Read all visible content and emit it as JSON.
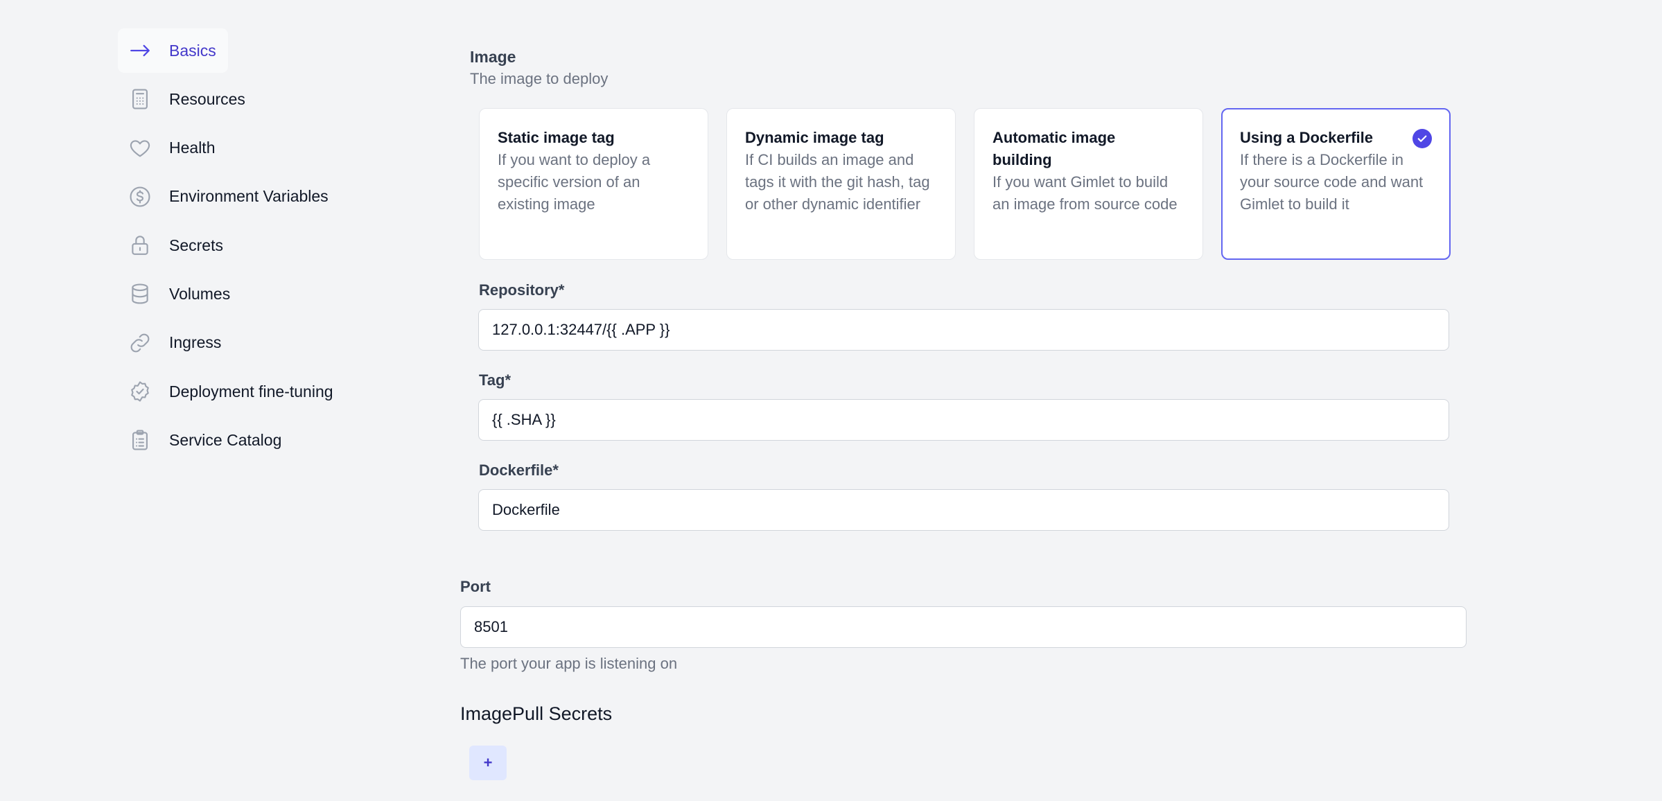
{
  "sidebar": {
    "items": [
      {
        "label": "Basics",
        "icon": "arrow-right-icon",
        "active": true
      },
      {
        "label": "Resources",
        "icon": "calculator-icon"
      },
      {
        "label": "Health",
        "icon": "heart-icon"
      },
      {
        "label": "Environment Variables",
        "icon": "currency-dollar-icon"
      },
      {
        "label": "Secrets",
        "icon": "lock-icon"
      },
      {
        "label": "Volumes",
        "icon": "database-icon"
      },
      {
        "label": "Ingress",
        "icon": "link-icon"
      },
      {
        "label": "Deployment fine-tuning",
        "icon": "badge-check-icon"
      },
      {
        "label": "Service Catalog",
        "icon": "clipboard-list-icon"
      }
    ]
  },
  "image": {
    "title": "Image",
    "description": "The image to deploy",
    "options": [
      {
        "title": "Static image tag",
        "description": "If you want to deploy a specific version of an existing image"
      },
      {
        "title": "Dynamic image tag",
        "description": "If CI builds an image and tags it with the git hash, tag or other dynamic identifier"
      },
      {
        "title": "Automatic image building",
        "description": "If you want Gimlet to build an image from source code"
      },
      {
        "title": "Using a Dockerfile",
        "description": "If there is a Dockerfile in your source code and want Gimlet to build it",
        "selected": true
      }
    ]
  },
  "repository": {
    "label": "Repository*",
    "value": "127.0.0.1:32447/{{ .APP }}"
  },
  "tag": {
    "label": "Tag*",
    "value": "{{ .SHA }}"
  },
  "dockerfile": {
    "label": "Dockerfile*",
    "value": "Dockerfile"
  },
  "port": {
    "label": "Port",
    "value": "8501",
    "help": "The port your app is listening on"
  },
  "imagepull": {
    "title": "ImagePull Secrets",
    "add_label": "+"
  },
  "colors": {
    "accent": "#4f46e5",
    "accent_text": "#4338ca",
    "background": "#f3f4f6"
  }
}
